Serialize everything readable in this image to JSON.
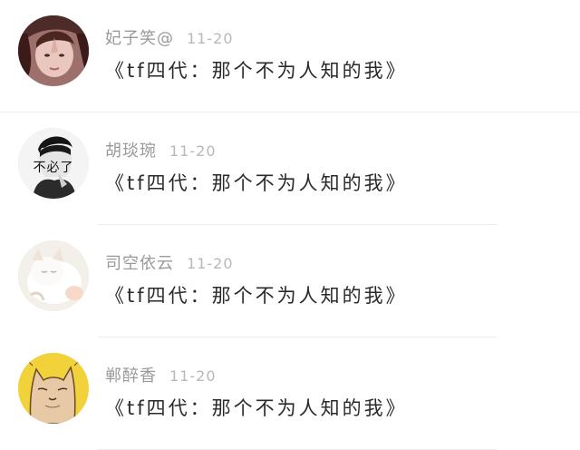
{
  "comments": [
    {
      "username": "妃子笑@",
      "date": "11-20",
      "message": "《tf四代：那个不为人知的我》",
      "avatar_icon": "girl-portrait-avatar"
    },
    {
      "username": "胡琰琬",
      "date": "11-20",
      "message": "《tf四代：那个不为人知的我》",
      "avatar_icon": "bw-man-sticker-avatar",
      "avatar_text": "不必了"
    },
    {
      "username": "司空依云",
      "date": "11-20",
      "message": "《tf四代：那个不为人知的我》",
      "avatar_icon": "white-cat-avatar"
    },
    {
      "username": "郸醉香",
      "date": "11-20",
      "message": "《tf四代：那个不为人知的我》",
      "avatar_icon": "cartoon-cat-avatar"
    }
  ],
  "colors": {
    "username": "#9a9a9a",
    "date": "#b8b8b8",
    "message": "#2a2a2a",
    "divider": "#ececec",
    "avatar_yellow": "#f2d23a"
  }
}
